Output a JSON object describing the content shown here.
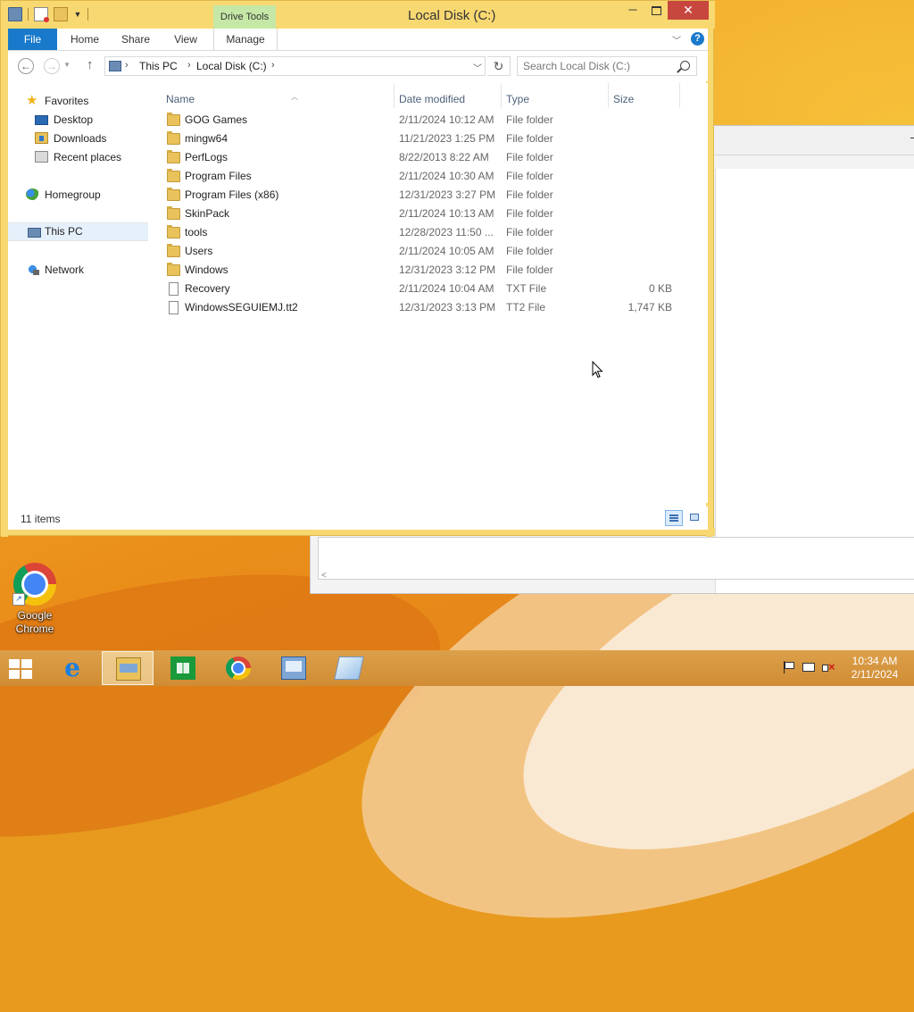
{
  "window": {
    "title": "Local Disk (C:)",
    "contextual_tab_group": "Drive Tools",
    "close_glyph": "✕",
    "minimize_glyph": "─"
  },
  "ribbon": {
    "tabs": [
      {
        "label": "File",
        "active": true
      },
      {
        "label": "Home"
      },
      {
        "label": "Share"
      },
      {
        "label": "View"
      },
      {
        "label": "Manage"
      }
    ],
    "help_glyph": "?"
  },
  "address": {
    "crumbs": [
      "This PC",
      "Local Disk (C:)"
    ],
    "separator": "›"
  },
  "search": {
    "placeholder": "Search Local Disk (C:)"
  },
  "nav_pane": {
    "items": [
      {
        "label": "Favorites",
        "icon": "star-icon"
      },
      {
        "label": "Desktop",
        "icon": "desktop-icon"
      },
      {
        "label": "Downloads",
        "icon": "downloads-icon"
      },
      {
        "label": "Recent places",
        "icon": "recent-places-icon"
      },
      {
        "label": "Homegroup",
        "icon": "homegroup-icon"
      },
      {
        "label": "This PC",
        "icon": "computer-icon",
        "selected": true
      },
      {
        "label": "Network",
        "icon": "network-icon"
      }
    ]
  },
  "columns": [
    "Name",
    "Date modified",
    "Type",
    "Size"
  ],
  "files": [
    {
      "name": "GOG Games",
      "date": "2/11/2024 10:12 AM",
      "type": "File folder",
      "size": "",
      "icon": "folder-icon"
    },
    {
      "name": "mingw64",
      "date": "11/21/2023 1:25 PM",
      "type": "File folder",
      "size": "",
      "icon": "folder-icon"
    },
    {
      "name": "PerfLogs",
      "date": "8/22/2013 8:22 AM",
      "type": "File folder",
      "size": "",
      "icon": "folder-icon"
    },
    {
      "name": "Program Files",
      "date": "2/11/2024 10:30 AM",
      "type": "File folder",
      "size": "",
      "icon": "folder-icon"
    },
    {
      "name": "Program Files (x86)",
      "date": "12/31/2023 3:27 PM",
      "type": "File folder",
      "size": "",
      "icon": "folder-icon"
    },
    {
      "name": "SkinPack",
      "date": "2/11/2024 10:13 AM",
      "type": "File folder",
      "size": "",
      "icon": "folder-icon"
    },
    {
      "name": "tools",
      "date": "12/28/2023 11:50 ...",
      "type": "File folder",
      "size": "",
      "icon": "folder-icon"
    },
    {
      "name": "Users",
      "date": "2/11/2024 10:05 AM",
      "type": "File folder",
      "size": "",
      "icon": "folder-icon"
    },
    {
      "name": "Windows",
      "date": "12/31/2023 3:12 PM",
      "type": "File folder",
      "size": "",
      "icon": "folder-icon"
    },
    {
      "name": "Recovery",
      "date": "2/11/2024 10:04 AM",
      "type": "TXT File",
      "size": "0 KB",
      "icon": "text-file-icon"
    },
    {
      "name": "WindowsSEGUIEMJ.tt2",
      "date": "12/31/2023 3:13 PM",
      "type": "TT2 File",
      "size": "1,747 KB",
      "icon": "file-icon"
    }
  ],
  "status": {
    "item_count": "11 items"
  },
  "desktop_icons": [
    {
      "label_line1": "Google",
      "label_line2": "Chrome",
      "icon": "chrome-icon"
    }
  ],
  "taskbar": {
    "apps": [
      {
        "name": "internet-explorer",
        "icon": "ie-icon"
      },
      {
        "name": "file-explorer",
        "icon": "file-explorer-icon",
        "active": true
      },
      {
        "name": "store",
        "icon": "store-icon"
      },
      {
        "name": "chrome",
        "icon": "chrome-icon"
      },
      {
        "name": "remote-desktop",
        "icon": "remote-desktop-icon"
      },
      {
        "name": "notepad",
        "icon": "notepad-icon"
      }
    ],
    "clock_time": "10:34 AM",
    "clock_date": "2/11/2024",
    "ie_glyph": "e"
  },
  "colors": {
    "accent": "#1979ca",
    "frame": "#f8d871",
    "close": "#c7463d",
    "context_tab": "#c5e8a6"
  }
}
